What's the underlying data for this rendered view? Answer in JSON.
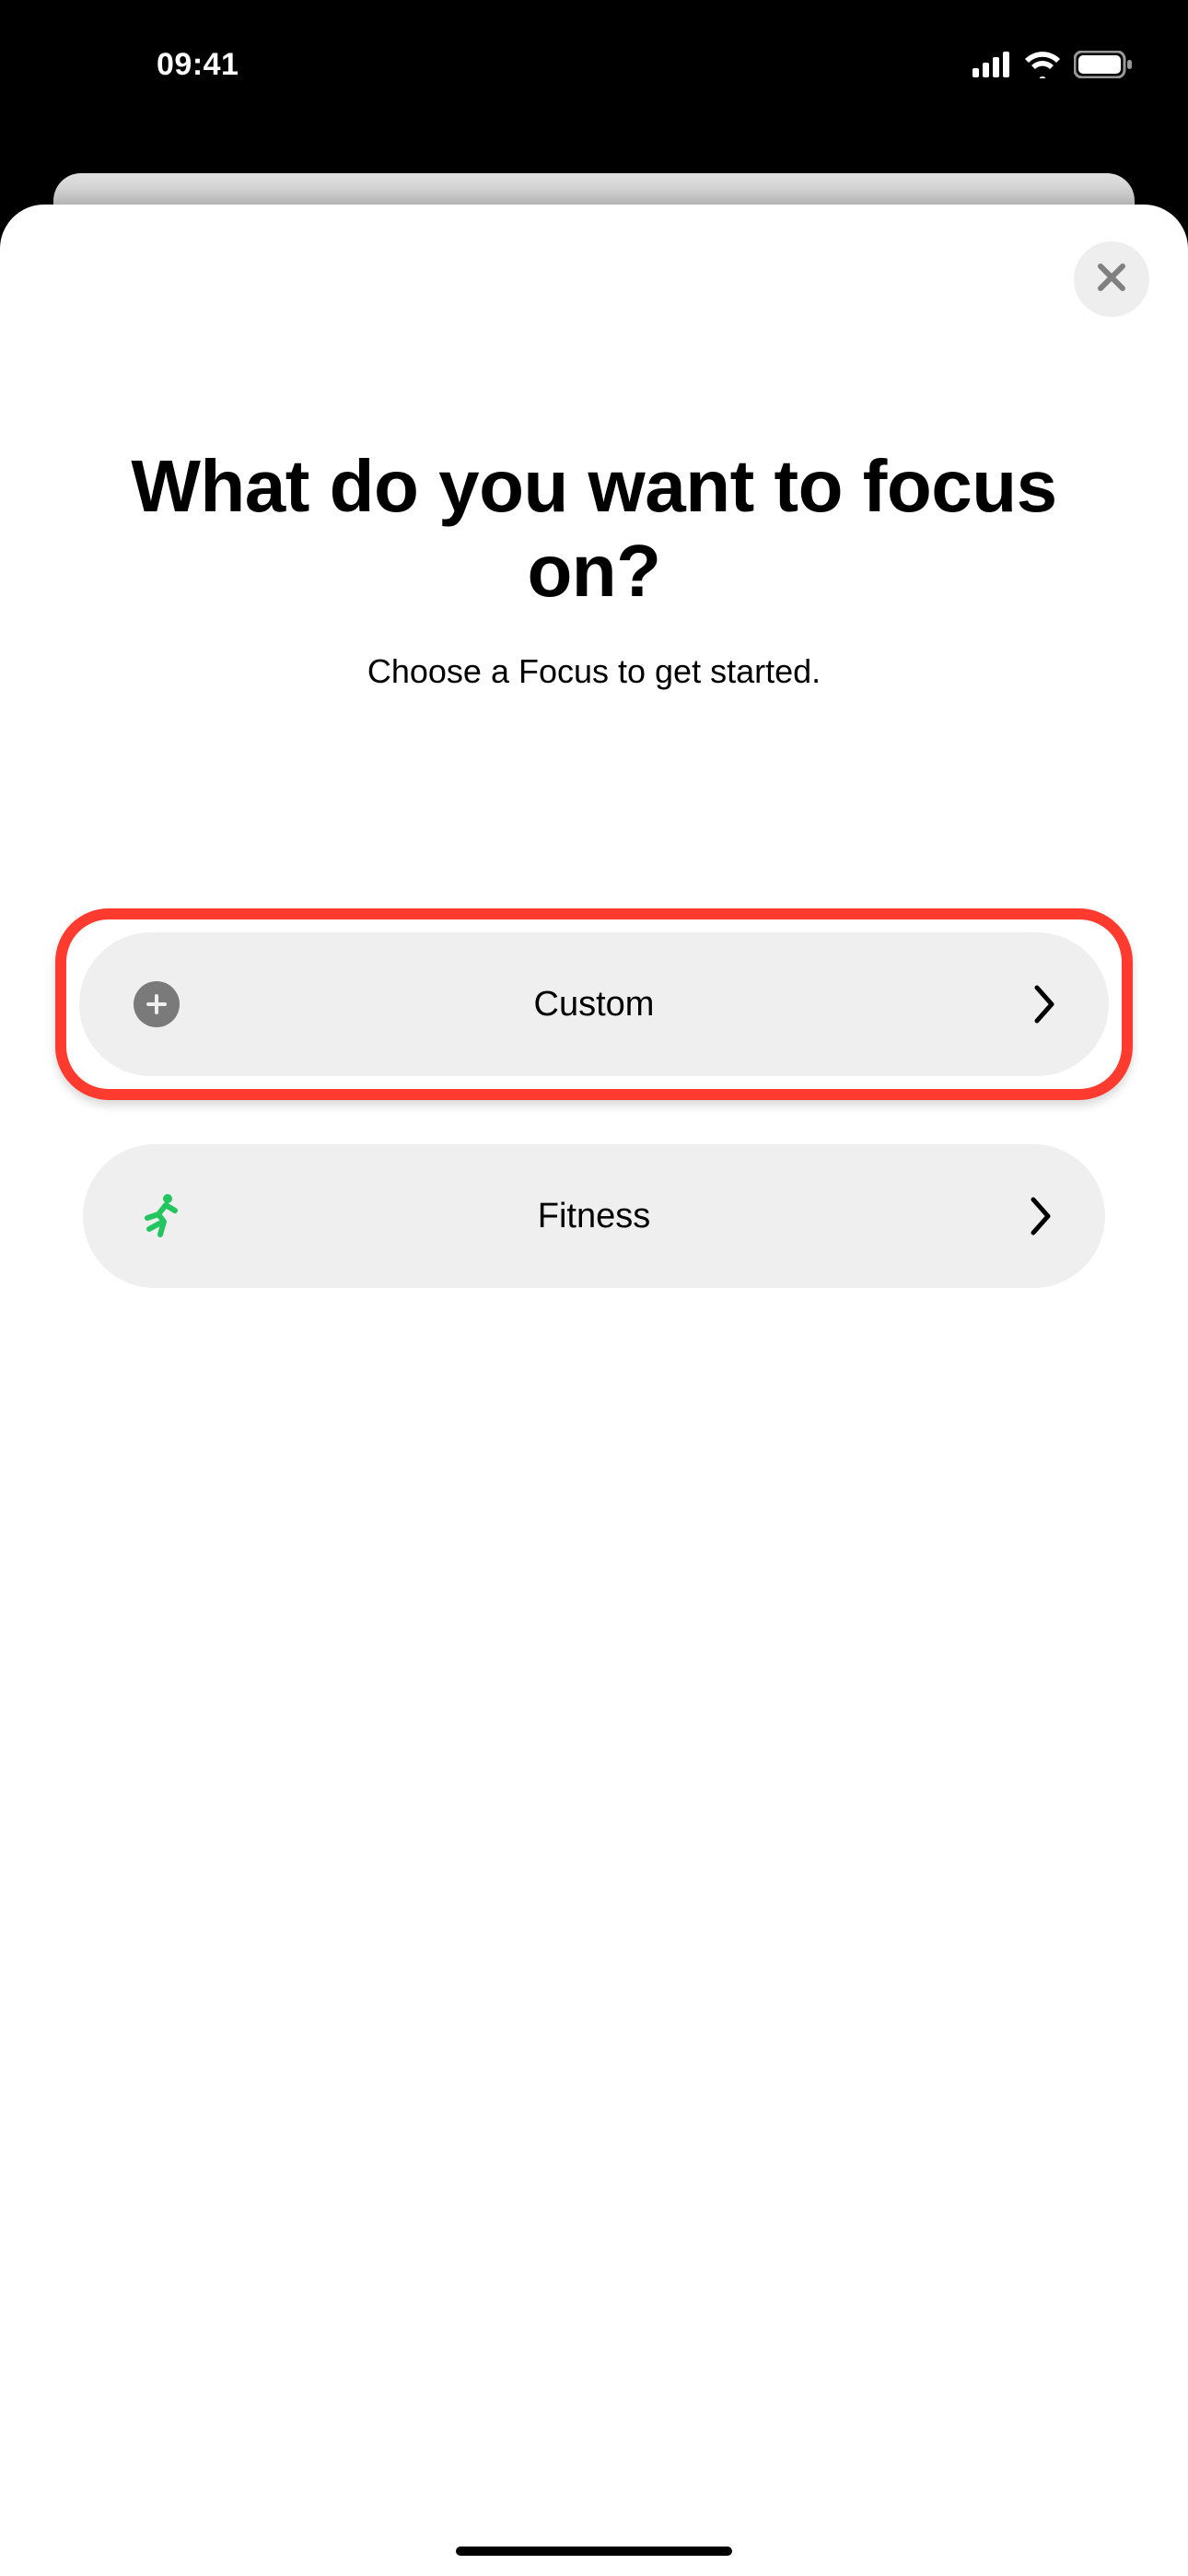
{
  "status": {
    "time": "09:41"
  },
  "modal": {
    "title": "What do you want to focus on?",
    "subtitle": "Choose a Focus to get started.",
    "options": {
      "custom": {
        "label": "Custom"
      },
      "fitness": {
        "label": "Fitness"
      }
    }
  }
}
